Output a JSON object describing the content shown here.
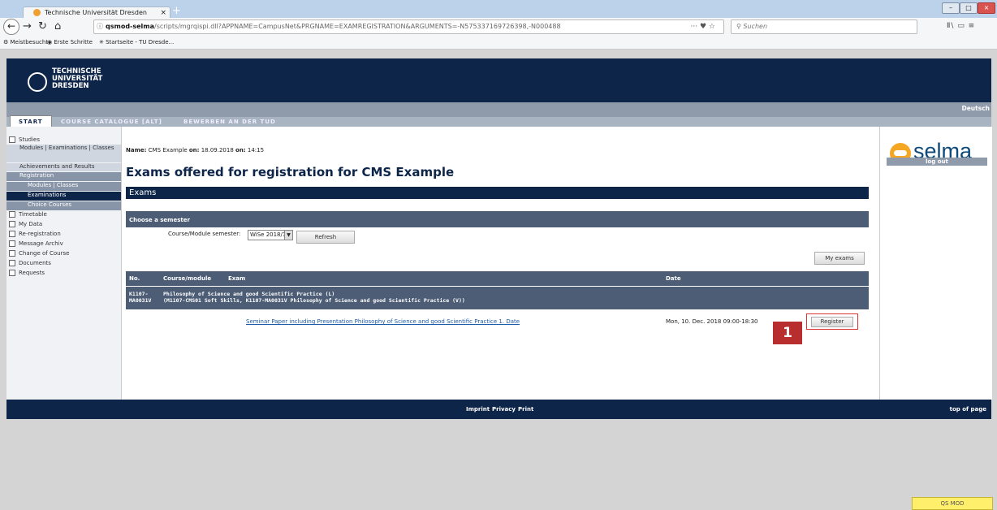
{
  "browser": {
    "tab_title": "Technische Universität Dresden",
    "tab_close": "×",
    "new_tab": "+",
    "url_host": "qsmod-selma",
    "url_rest": "/scripts/mgrqispi.dll?APPNAME=CampusNet&PRGNAME=EXAMREGISTRATION&ARGUMENTS=-N575337169726398,-N000488,",
    "url_actions": "··· ♥ ☆",
    "search_placeholder": "Suchen",
    "toolbar_icons": "Ⅱ\\  ▭  ≡",
    "bookmarks": [
      "Meistbesucht",
      "Erste Schritte",
      "Startseite - TU Dresde..."
    ]
  },
  "header": {
    "logo_line1": "TECHNISCHE",
    "logo_line2": "UNIVERSITÄT",
    "logo_line3": "DRESDEN",
    "language": "Deutsch"
  },
  "menu": {
    "start": "START",
    "catalogue": "COURSE CATALOGUE [ALT]",
    "apply": "BEWERBEN AN DER TUD"
  },
  "sidebar": [
    {
      "label": "Studies",
      "level": 0
    },
    {
      "label": "Modules | Examinations | Classes",
      "level": 1
    },
    {
      "label": "Achievements and Results",
      "level": 1
    },
    {
      "label": "Registration",
      "level": 1,
      "state": "open"
    },
    {
      "label": "Modules | Classes",
      "level": 2
    },
    {
      "label": "Examinations",
      "level": 2,
      "state": "selected"
    },
    {
      "label": "Choice Courses",
      "level": 2
    },
    {
      "label": "Timetable",
      "level": 0
    },
    {
      "label": "My Data",
      "level": 0
    },
    {
      "label": "Re-registration",
      "level": 0
    },
    {
      "label": "Message Archiv",
      "level": 0
    },
    {
      "label": "Change of Course",
      "level": 0
    },
    {
      "label": "Documents",
      "level": 0
    },
    {
      "label": "Requests",
      "level": 0
    }
  ],
  "page": {
    "name_label": "Name:",
    "name_value": "CMS Example",
    "on_label1": "on:",
    "date_value": "18.09.2018",
    "on_label2": "on:",
    "time_value": "14:15",
    "title": "Exams offered for registration for CMS Example",
    "section_exams": "Exams",
    "section_semester": "Choose a semester",
    "semester_label": "Course/Module semester:",
    "semester_value": "WiSe 2018/19",
    "refresh_label": "Refresh",
    "my_exams_label": "My exams",
    "col_no": "No.",
    "col_course": "Course/module",
    "col_exam": "Exam",
    "col_date": "Date",
    "group_no": "K1107-\nMA0031V",
    "group_title": "Philosophy of Science and good Scientific Practice (L)",
    "group_sub": "(M1107-CMS01 Soft Skills, K1107-MA0031V Philosophy of Science and good Scientific Practice (V))",
    "exam_link": "Seminar Paper including Presentation Philosophy of Science and good Scientific Practice 1. Date",
    "exam_date": "Mon, 10. Dec. 2018 09:00-18:30",
    "register_label": "Register",
    "marker": "1"
  },
  "footer": {
    "imprint": "Imprint",
    "privacy": "Privacy",
    "print": "Print",
    "top": "top of page"
  },
  "right": {
    "brand": "selma",
    "logout": "log out"
  },
  "qsmod": "QS MOD"
}
